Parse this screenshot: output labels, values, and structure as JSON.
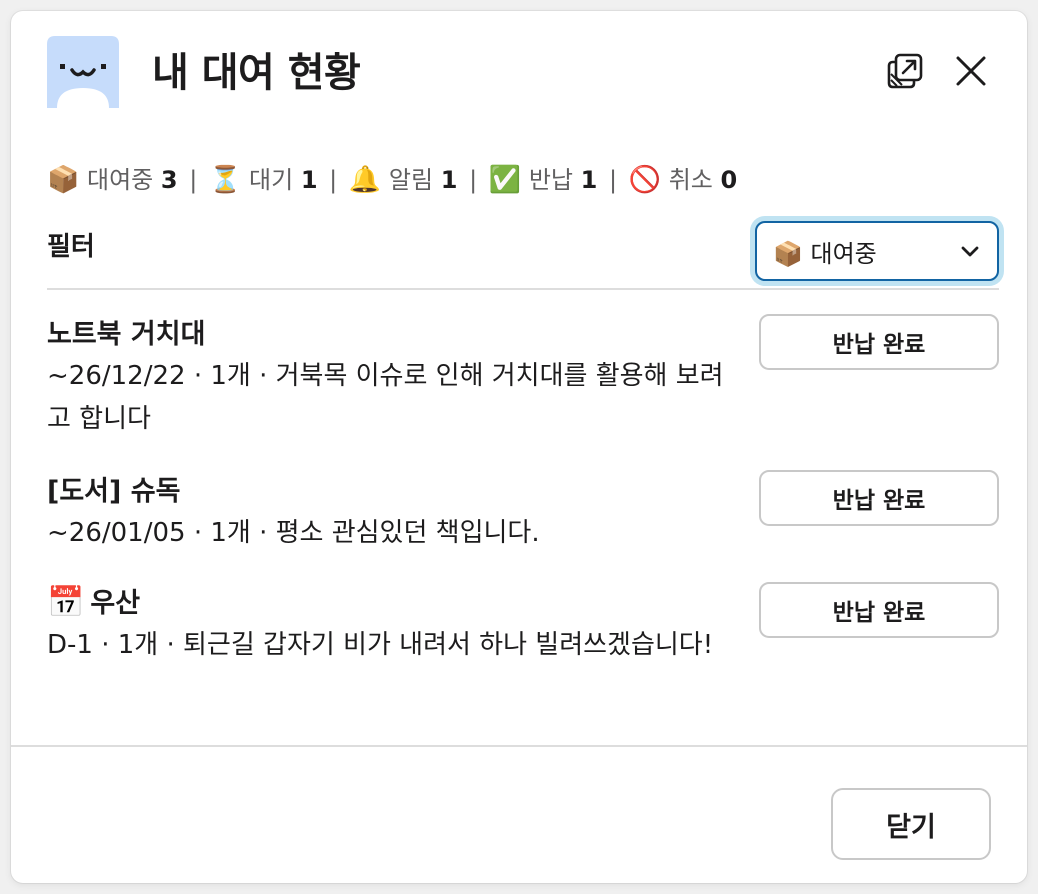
{
  "header": {
    "title": "내 대여 현황",
    "app_icon": "face-icon",
    "app_icon_color": "#c6dcfb"
  },
  "summary": {
    "items": [
      {
        "icon": "📦",
        "label": "대여중",
        "count": "3"
      },
      {
        "icon": "⏳",
        "label": "대기",
        "count": "1"
      },
      {
        "icon": "🔔",
        "label": "알림",
        "count": "1"
      },
      {
        "icon": "✅",
        "label": "반납",
        "count": "1"
      },
      {
        "icon": "🚫",
        "label": "취소",
        "count": "0"
      }
    ],
    "separator": "|"
  },
  "filter": {
    "label": "필터",
    "selected": "📦 대여중"
  },
  "rentals": [
    {
      "emoji": "",
      "title": "노트북 거치대",
      "desc": "~26/12/22 · 1개 · 거북목 이슈로 인해 거치대를 활용해 보려고 합니다",
      "button": "반납 완료"
    },
    {
      "emoji": "",
      "title": "[도서] 슈독",
      "desc": "~26/01/05 · 1개 · 평소 관심있던 책입니다.",
      "button": "반납 완료"
    },
    {
      "emoji": "📅",
      "title": "우산",
      "desc": "D-1 · 1개 · 퇴근길 갑자기 비가 내려서 하나 빌려쓰겠습니다!",
      "button": "반납 완료"
    }
  ],
  "footer": {
    "close_label": "닫기"
  },
  "colors": {
    "focus": "#1264a3",
    "border": "#c8c8c8",
    "muted_text": "#616061"
  }
}
